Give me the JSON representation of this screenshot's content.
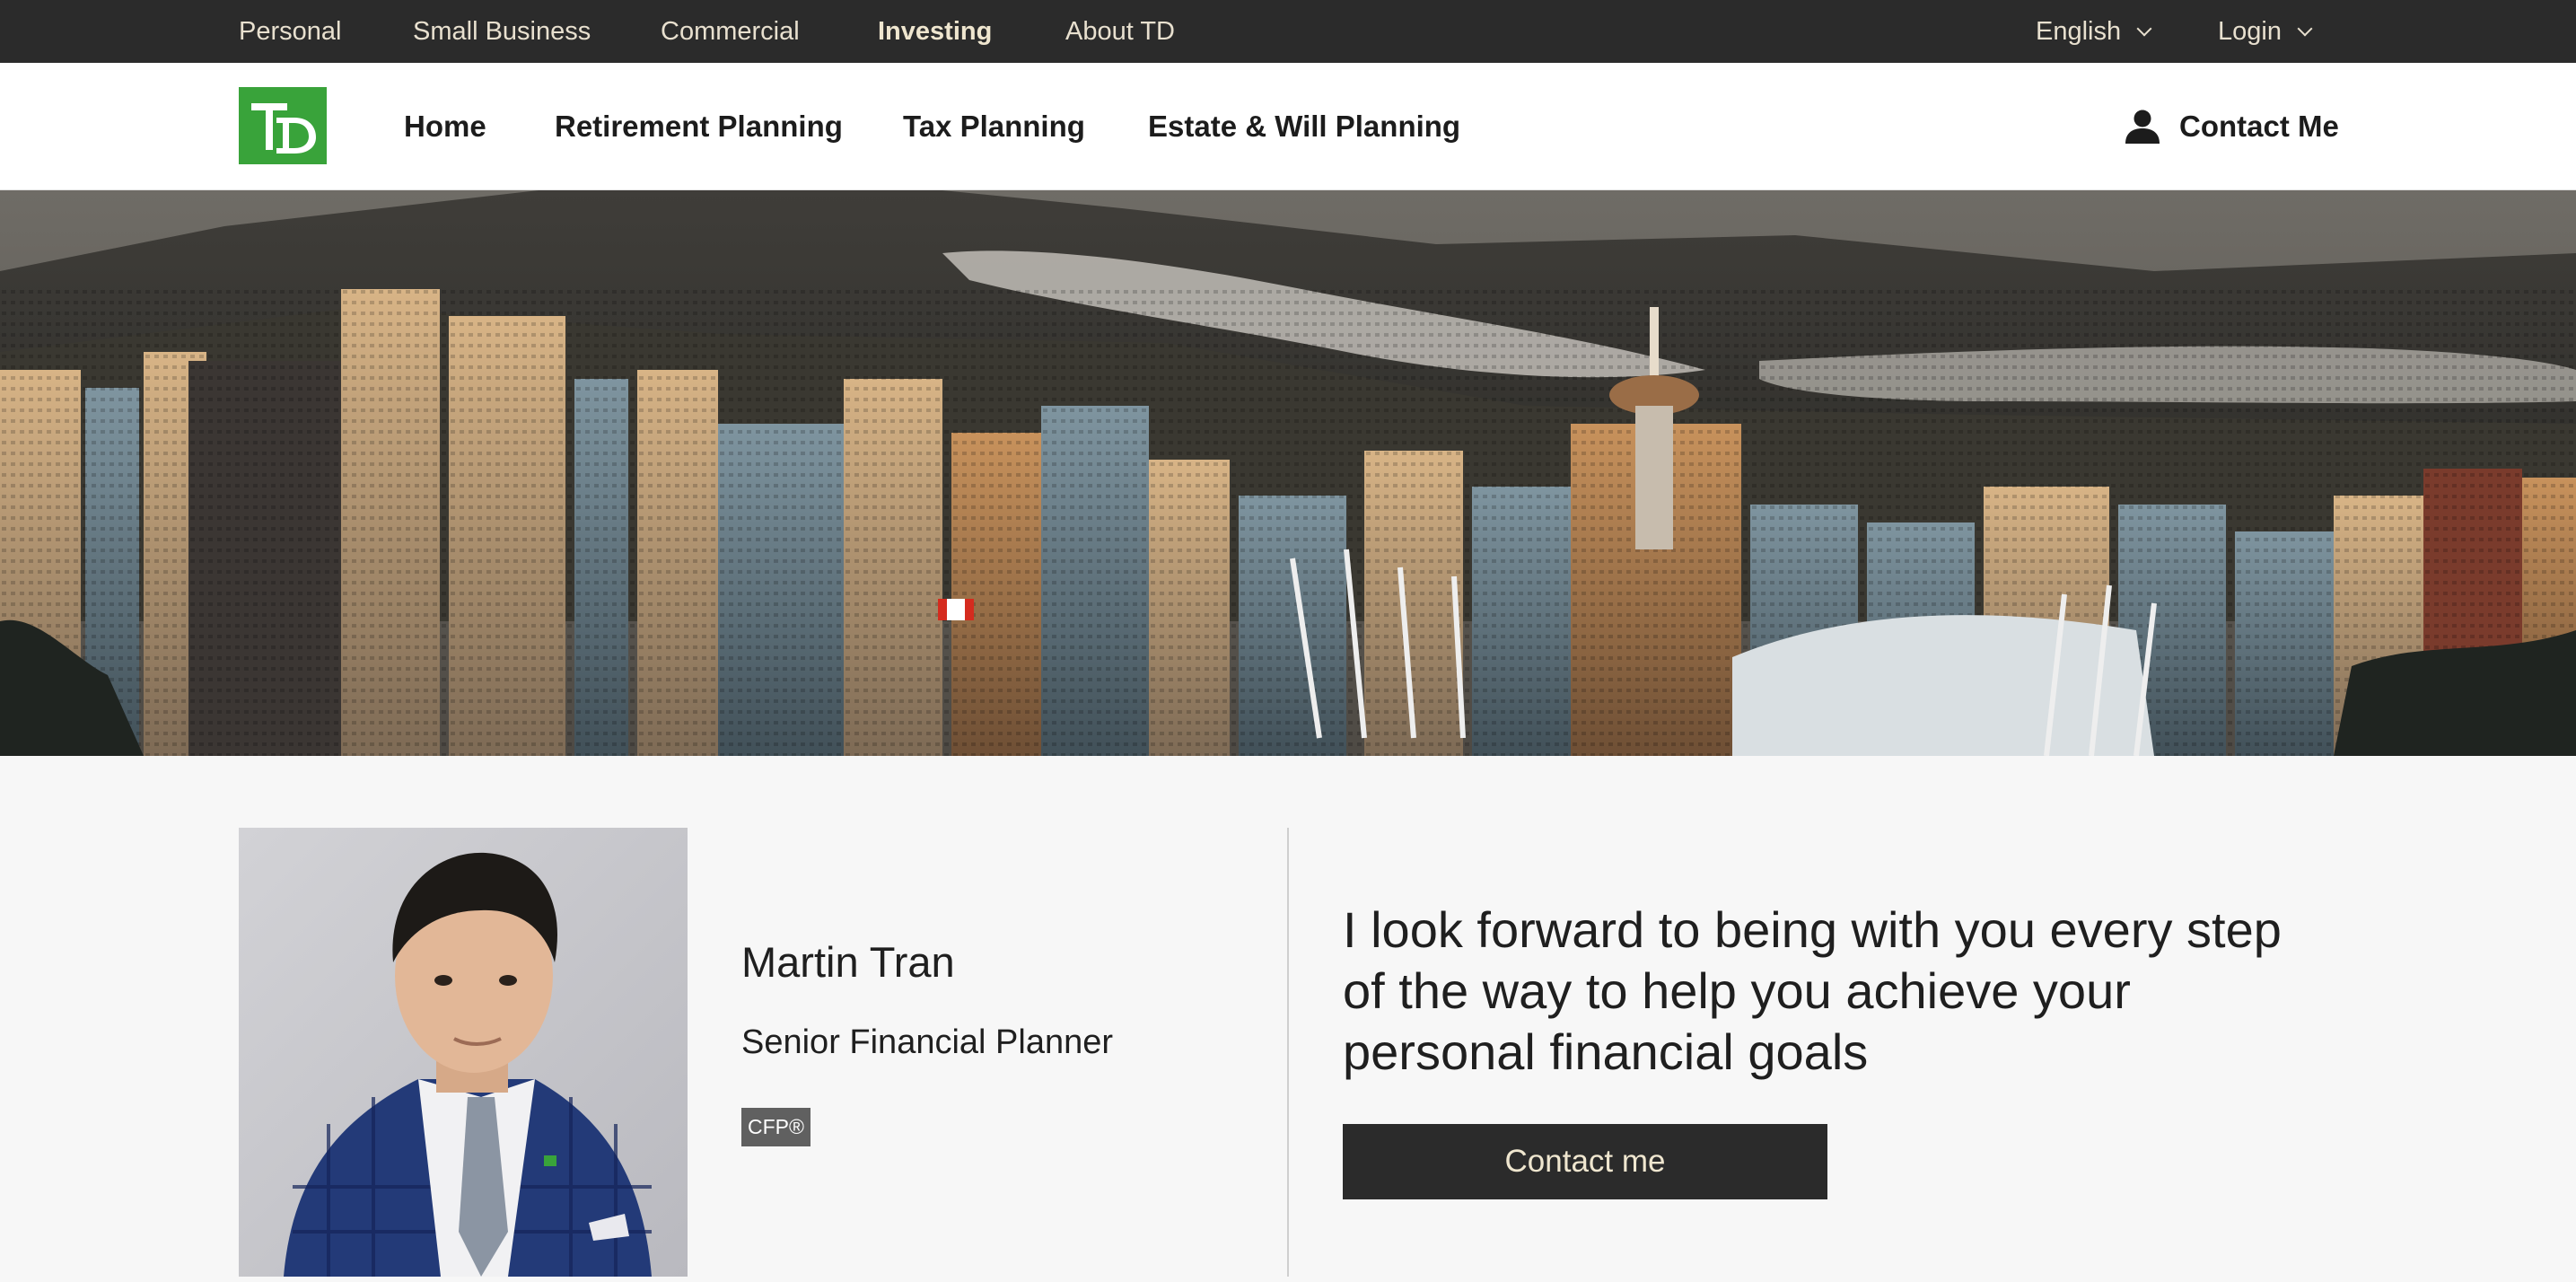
{
  "topbar": {
    "links": [
      {
        "label": "Personal"
      },
      {
        "label": "Small Business"
      },
      {
        "label": "Commercial"
      },
      {
        "label": "Investing",
        "active": true
      },
      {
        "label": "About TD"
      }
    ],
    "language": "English",
    "login": "Login"
  },
  "mainnav": {
    "logo_text": "TD",
    "items": [
      {
        "label": "Home"
      },
      {
        "label": "Retirement Planning"
      },
      {
        "label": "Tax Planning"
      },
      {
        "label": "Estate & Will Planning"
      }
    ],
    "contact": "Contact Me"
  },
  "profile": {
    "name": "Martin Tran",
    "title": "Senior Financial Planner",
    "designation": "CFP®",
    "quote": "I look forward to being with you every step of the way to help you achieve your personal financial goals",
    "cta_label": "Contact me"
  },
  "colors": {
    "topbar_bg": "#2b2b2b",
    "brand_green": "#39a33a",
    "cta_bg": "#2b2b2b",
    "cta_text": "#efe6cf"
  },
  "icons": [
    "chevron-down-icon",
    "person-icon"
  ]
}
